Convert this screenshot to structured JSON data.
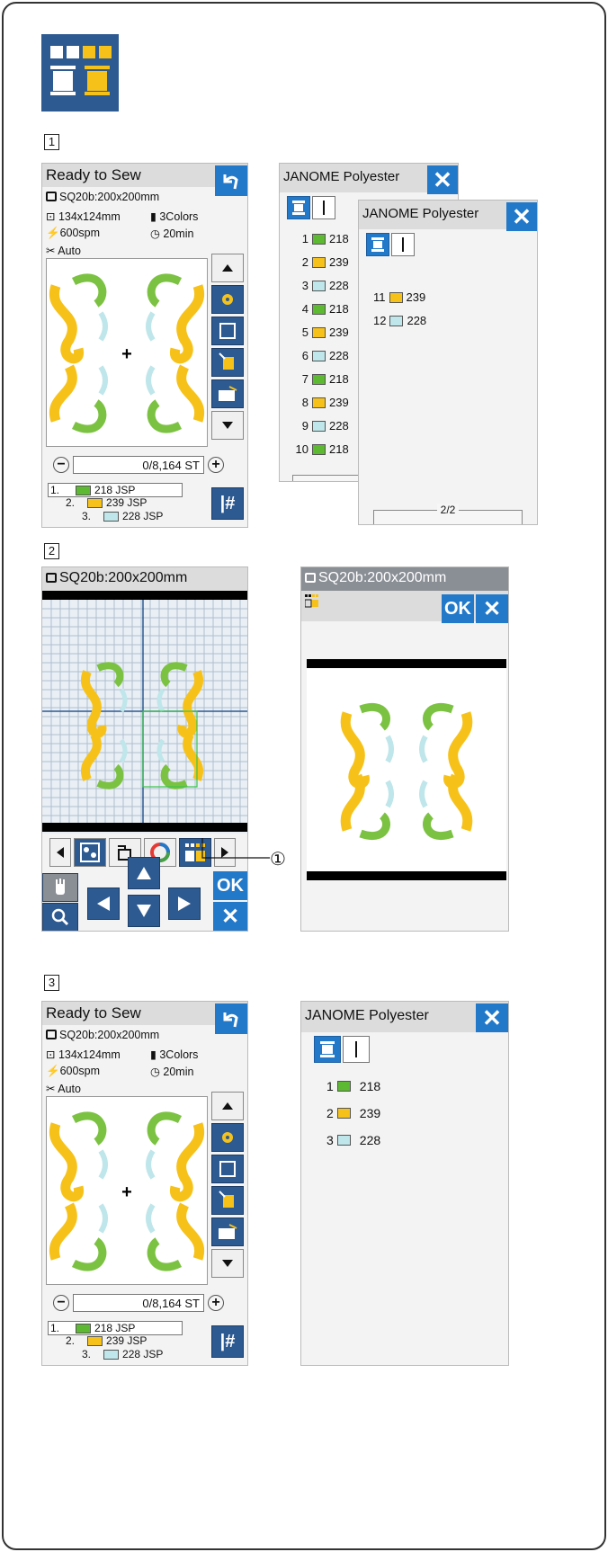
{
  "steps": [
    "1",
    "2",
    "3"
  ],
  "callout_number": "①",
  "ready_screen": {
    "title": "Ready to Sew",
    "hoop": "SQ20b:200x200mm",
    "size": "134x124mm",
    "colors_count": "3Colors",
    "speed": "600spm",
    "time": "20min",
    "cut_mode": "Auto",
    "stitch_count": "0/8,164 ST",
    "color_list": [
      {
        "index": "1.",
        "code": "218 JSP",
        "color": "#5db832"
      },
      {
        "index": "2.",
        "code": "239 JSP",
        "color": "#f6c21a"
      },
      {
        "index": "3.",
        "code": "228 JSP",
        "color": "#bfe6ea"
      }
    ]
  },
  "thread_panel_1": {
    "title": "JANOME Polyester",
    "rows": [
      {
        "n": "1",
        "code": "218",
        "color": "#5db832"
      },
      {
        "n": "2",
        "code": "239",
        "color": "#f6c21a"
      },
      {
        "n": "3",
        "code": "228",
        "color": "#bfe6ea"
      },
      {
        "n": "4",
        "code": "218",
        "color": "#5db832"
      },
      {
        "n": "5",
        "code": "239",
        "color": "#f6c21a"
      },
      {
        "n": "6",
        "code": "228",
        "color": "#bfe6ea"
      },
      {
        "n": "7",
        "code": "218",
        "color": "#5db832"
      },
      {
        "n": "8",
        "code": "239",
        "color": "#f6c21a"
      },
      {
        "n": "9",
        "code": "228",
        "color": "#bfe6ea"
      },
      {
        "n": "10",
        "code": "218",
        "color": "#5db832"
      }
    ]
  },
  "thread_panel_2": {
    "title": "JANOME Polyester",
    "rows": [
      {
        "n": "11",
        "code": "239",
        "color": "#f6c21a"
      },
      {
        "n": "12",
        "code": "228",
        "color": "#bfe6ea"
      }
    ],
    "page": "2/2"
  },
  "edit_screen": {
    "hoop": "SQ20b:200x200mm",
    "ok_label": "OK"
  },
  "grouping_screen": {
    "hoop": "SQ20b:200x200mm",
    "ok_label": "OK"
  },
  "thread_panel_3": {
    "title": "JANOME Polyester",
    "rows": [
      {
        "n": "1",
        "code": "218",
        "color": "#5db832"
      },
      {
        "n": "2",
        "code": "239",
        "color": "#f6c21a"
      },
      {
        "n": "3",
        "code": "228",
        "color": "#bfe6ea"
      }
    ]
  },
  "colors": {
    "accent_blue": "#2379c9",
    "dark_blue": "#2d5a91",
    "green": "#5db832",
    "yellow": "#f6c21a",
    "light_blue": "#bfe6ea"
  }
}
